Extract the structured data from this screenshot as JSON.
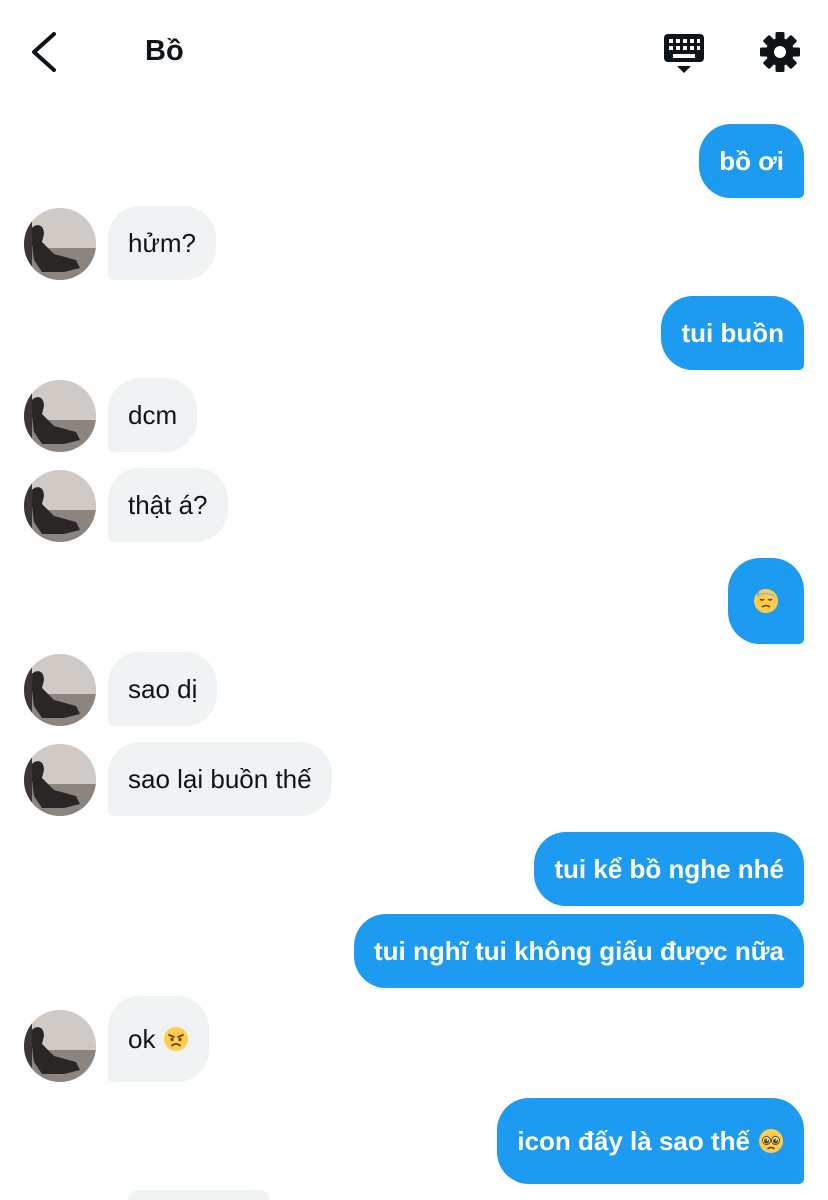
{
  "header": {
    "title": "Bồ"
  },
  "colors": {
    "outgoing_bubble": "#1d9bf0",
    "incoming_bubble": "#eff3f4",
    "outgoing_text": "#ffffff",
    "incoming_text": "#0f1419"
  },
  "icons": {
    "back": "back-arrow-icon",
    "keyboard": "keyboard-icon",
    "settings": "gear-icon"
  },
  "messages": [
    {
      "sender": "me",
      "text": "bồ ơi"
    },
    {
      "sender": "them",
      "text": "hửm?"
    },
    {
      "sender": "me",
      "text": "tui buồn"
    },
    {
      "sender": "them",
      "text": "dcm"
    },
    {
      "sender": "them",
      "text": "thật á?"
    },
    {
      "sender": "me",
      "text": "",
      "emoji": "downcast-sweat-face"
    },
    {
      "sender": "them",
      "text": "sao dị"
    },
    {
      "sender": "them",
      "text": "sao lại buồn thế"
    },
    {
      "sender": "me",
      "text": "tui kể bồ nghe nhé"
    },
    {
      "sender": "me",
      "text": "tui nghĩ tui không giấu được nữa"
    },
    {
      "sender": "them",
      "text": "ok",
      "emoji": "angry-face"
    },
    {
      "sender": "me",
      "text": "icon đấy là sao thế",
      "emoji": "pleading-face"
    }
  ]
}
